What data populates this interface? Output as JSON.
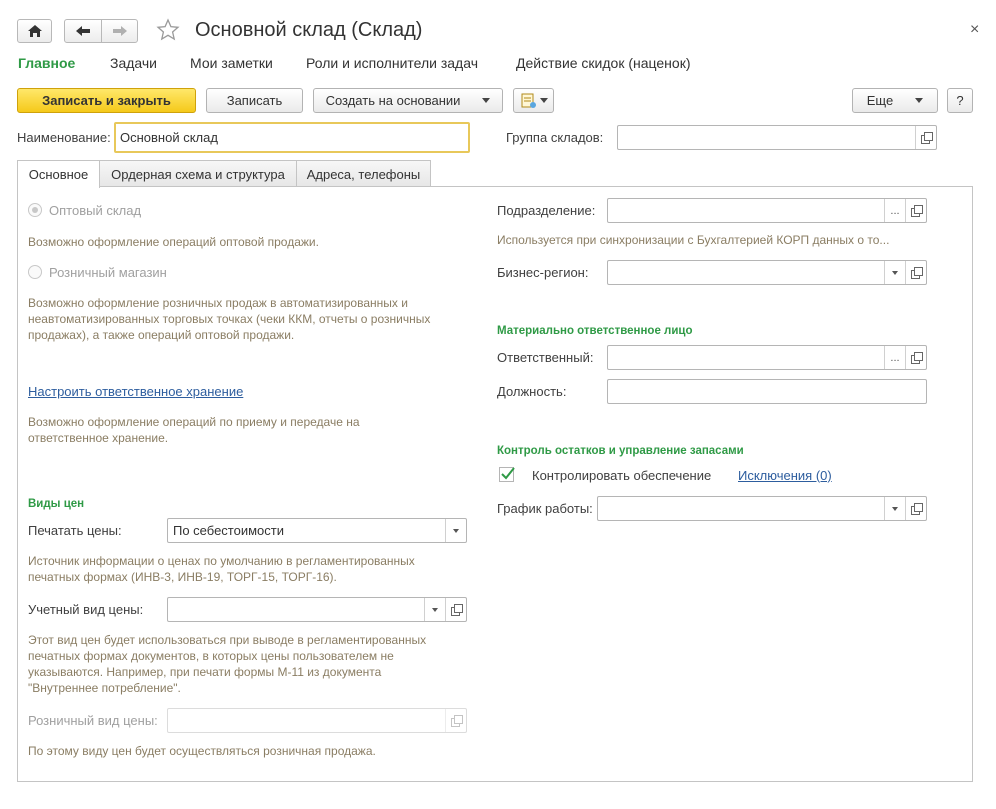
{
  "window": {
    "title": "Основной склад (Склад)",
    "close_glyph": "×"
  },
  "nav": [
    "Главное",
    "Задачи",
    "Мои заметки",
    "Роли и исполнители задач",
    "Действие скидок (наценок)"
  ],
  "toolbar": {
    "save_close": "Записать и закрыть",
    "save": "Записать",
    "create_based_on": "Создать на основании",
    "more": "Еще",
    "help": "?"
  },
  "header": {
    "name_label": "Наименование:",
    "name_value": "Основной склад",
    "group_label": "Группа складов:",
    "group_value": ""
  },
  "tabs": [
    "Основное",
    "Ордерная схема и структура",
    "Адреса, телефоны"
  ],
  "left": {
    "wholesale_label": "Оптовый склад",
    "wholesale_hint": "Возможно оформление операций оптовой продажи.",
    "retail_label": "Розничный магазин",
    "retail_hint": [
      "Возможно оформление розничных продаж в автоматизированных и",
      "неавтоматизированных торговых точках (чеки ККМ, отчеты о розничных",
      "продажах), а также операций оптовой продажи."
    ],
    "custody_link": "Настроить ответственное хранение",
    "custody_hint": [
      "Возможно оформление операций по приему и передаче на",
      "ответственное хранение."
    ],
    "prices_group": "Виды цен",
    "print_prices_label": "Печатать цены:",
    "print_prices_value": "По себестоимости",
    "print_prices_hint": [
      "Источник информации о ценах по умолчанию в регламентированных",
      "печатных формах (ИНВ-3, ИНВ-19, ТОРГ-15, ТОРГ-16)."
    ],
    "account_price_label": "Учетный вид цены:",
    "account_price_value": "",
    "account_price_hint": [
      "Этот вид цен будет использоваться при выводе в регламентированных",
      "печатных формах документов, в которых цены пользователем не",
      "указываются. Например, при печати формы М-11 из документа",
      "\"Внутреннее потребление\"."
    ],
    "retail_price_label": "Розничный вид цены:",
    "retail_price_value": "",
    "retail_price_hint": "По этому виду цен будет осуществляться розничная продажа."
  },
  "right": {
    "division_label": "Подразделение:",
    "division_value": "",
    "division_hint": "Используется при синхронизации с Бухгалтерией КОРП данных о то...",
    "region_label": "Бизнес-регион:",
    "region_value": "",
    "mrp_group": "Материально ответственное лицо",
    "responsible_label": "Ответственный:",
    "responsible_value": "",
    "position_label": "Должность:",
    "position_value": "",
    "stock_group": "Контроль остатков и управление запасами",
    "control_supply_label": "Контролировать обеспечение",
    "control_supply_checked": true,
    "exceptions_link": "Исключения (0)",
    "schedule_label": "График работы:",
    "schedule_value": ""
  },
  "colors": {
    "accent_green": "#2f9a46",
    "primary_button": "#f5c91a",
    "focus_border": "#e8c85a",
    "hint_text": "#8a7d63",
    "link": "#2d5d9e"
  },
  "icons": [
    "home-icon",
    "back-arrow-icon",
    "forward-arrow-icon",
    "favorite-star-icon",
    "close-icon",
    "report-menu-icon",
    "open-form-icon",
    "dropdown-icon",
    "select-icon",
    "checkmark-icon"
  ]
}
